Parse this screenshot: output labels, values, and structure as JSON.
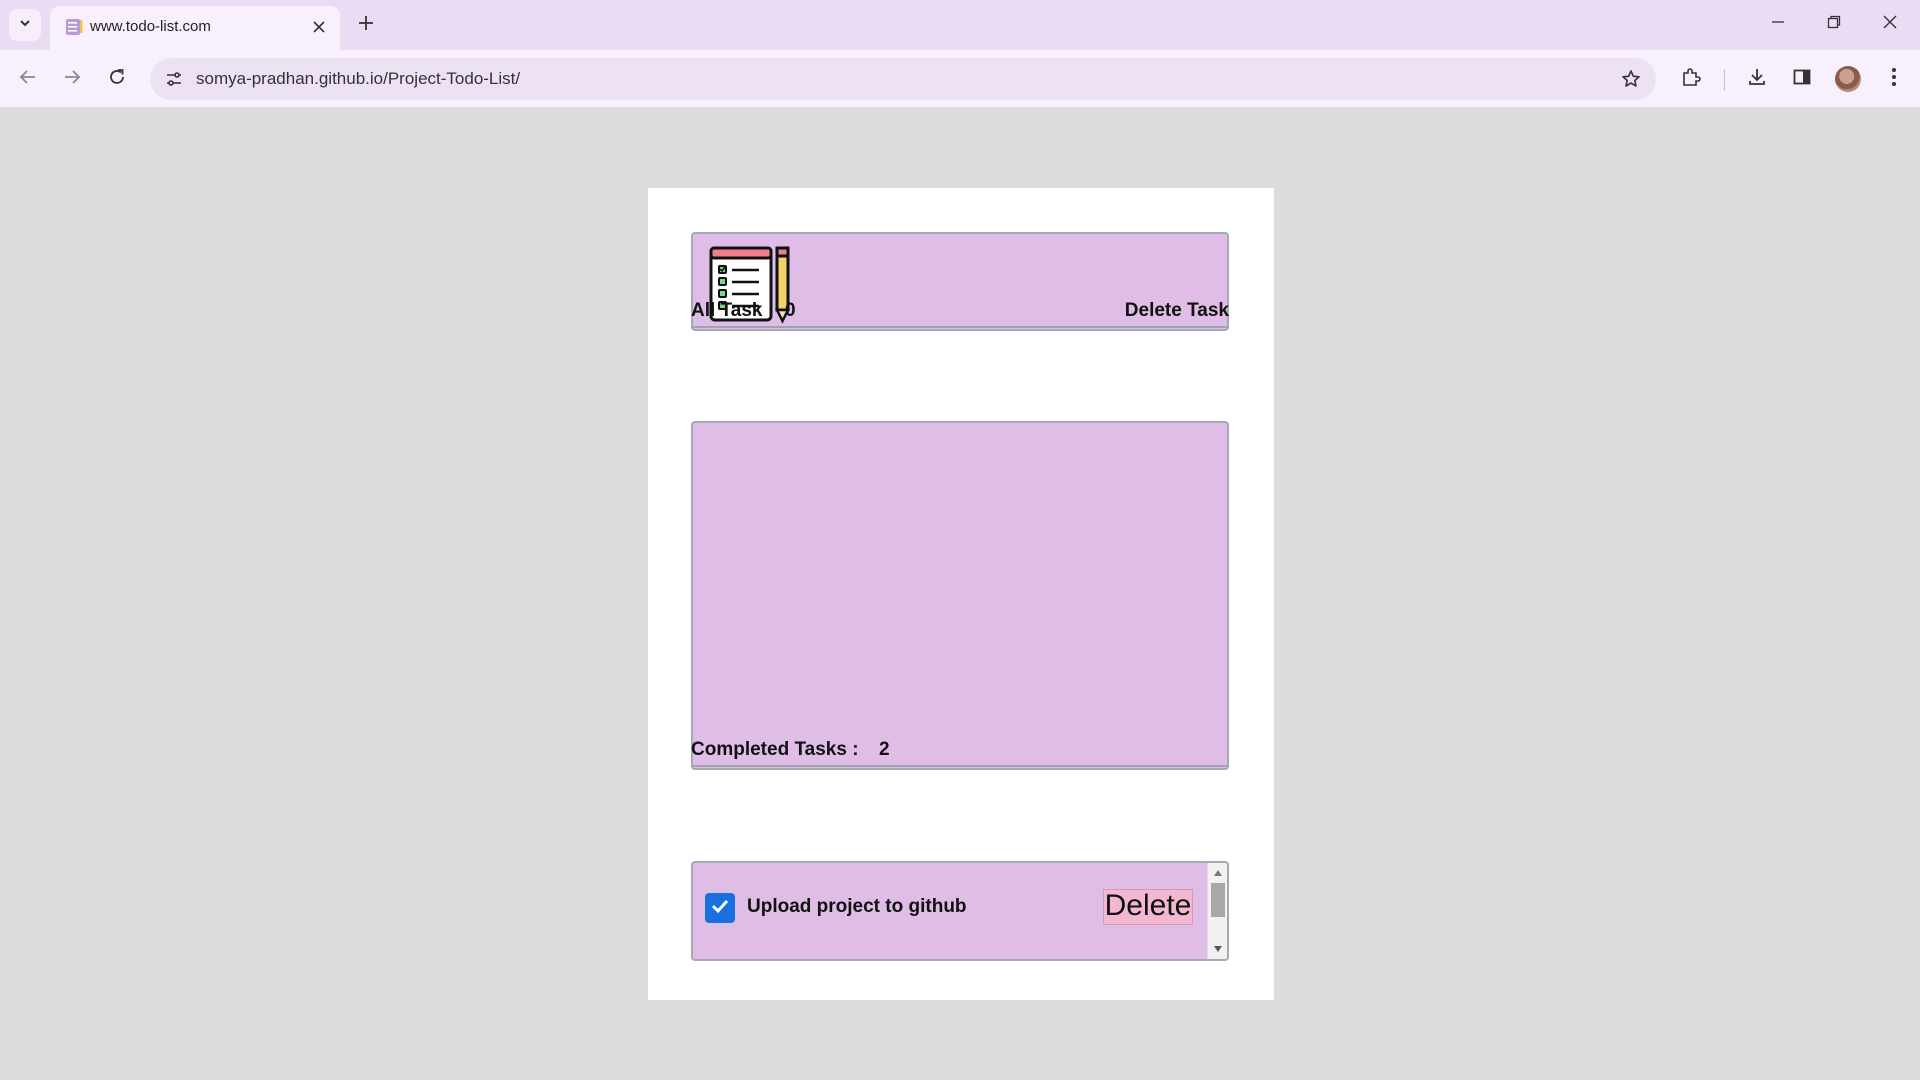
{
  "browser": {
    "tab_title": "www.todo-list.com",
    "url": "somya-pradhan.github.io/Project-Todo-List/"
  },
  "stats": {
    "all_task_label": "All Task :",
    "all_task_count": "0",
    "delete_task_label": "Delete Task",
    "completed_label": "Completed Tasks :",
    "completed_count": "2"
  },
  "completed_tasks": [
    {
      "text": "Upload project to github",
      "checked": true,
      "delete_label": "Delete"
    }
  ],
  "colors": {
    "panel": "#e0bde6",
    "delete_button": "#f3b8cf",
    "checkbox": "#1a6fe0",
    "page_background": "#dcdcdc"
  }
}
